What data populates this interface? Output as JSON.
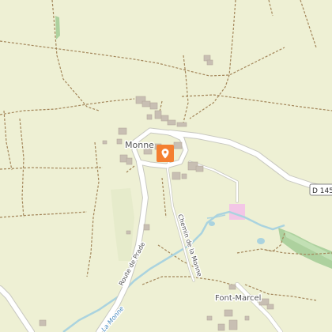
{
  "map": {
    "colors": {
      "land": "#eef0d4",
      "road": "#ffffff",
      "road_casing": "#c8c8c0",
      "track": "#a3865a",
      "water": "#aad3df",
      "building": "#c8bfb3",
      "woodland": "#add19e",
      "pitch": "#f3c6e6",
      "marker": "#f47f30",
      "text": "#555555",
      "water_text": "#4a8bbf"
    },
    "labels": {
      "village": "Monne",
      "hamlet": "Font-Marcel",
      "road_prade": "Route de Prade",
      "road_chemin": "Chemin de la Monne",
      "road_badge": "D 145",
      "river": "La Monne"
    },
    "marker": {
      "icon": "location-pin-icon"
    }
  }
}
